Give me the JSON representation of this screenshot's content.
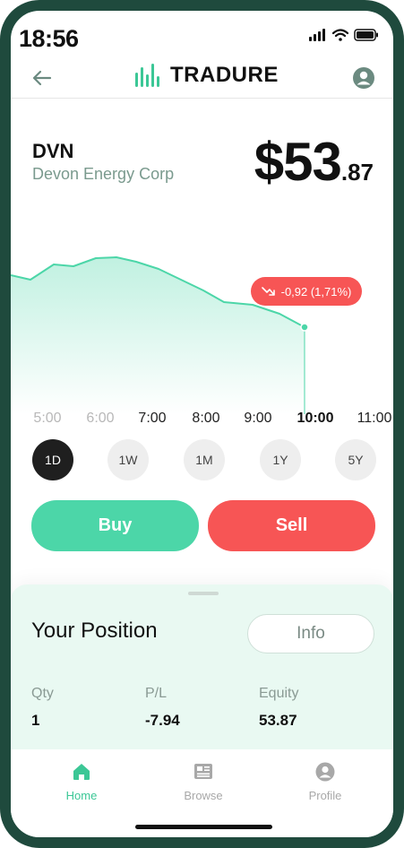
{
  "status_bar": {
    "time": "18:56"
  },
  "header": {
    "brand": "TRADURE"
  },
  "stock": {
    "ticker": "DVN",
    "company": "Devon Energy Corp",
    "price_int": "$53",
    "price_dec": ".87",
    "change": "-0,92 (1,71%)"
  },
  "chart": {
    "time_labels": [
      "5:00",
      "6:00",
      "7:00",
      "8:00",
      "9:00",
      "10:00",
      "11:00"
    ],
    "active_time": "10:00",
    "accent": "#4cd6a8",
    "down": "#f75555"
  },
  "ranges": {
    "items": [
      "1D",
      "1W",
      "1M",
      "1Y",
      "5Y"
    ],
    "active": "1D"
  },
  "actions": {
    "buy": "Buy",
    "sell": "Sell"
  },
  "position": {
    "title": "Your Position",
    "info_label": "Info",
    "stats": [
      {
        "label": "Qty",
        "value": "1"
      },
      {
        "label": "P/L",
        "value": "-7.94"
      },
      {
        "label": "Equity",
        "value": "53.87"
      }
    ]
  },
  "nav": {
    "items": [
      {
        "label": "Home",
        "icon": "home-icon"
      },
      {
        "label": "Browse",
        "icon": "news-icon"
      },
      {
        "label": "Profile",
        "icon": "profile-icon"
      }
    ],
    "active": "Home"
  }
}
